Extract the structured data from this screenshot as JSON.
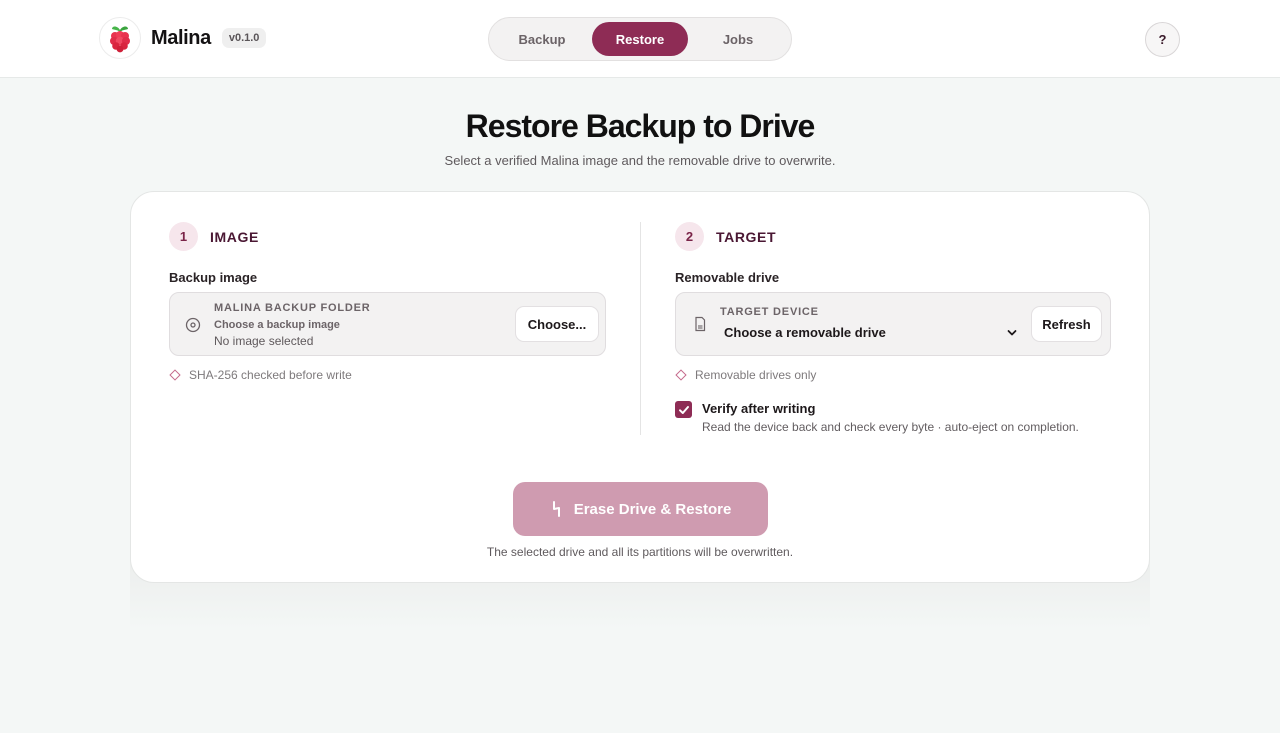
{
  "app": {
    "name": "Malina",
    "version": "v0.1.0"
  },
  "nav": {
    "tabs": [
      {
        "label": "Backup"
      },
      {
        "label": "Restore"
      },
      {
        "label": "Jobs"
      }
    ],
    "active": "Restore"
  },
  "help": {
    "label": "?"
  },
  "page": {
    "title": "Restore Backup to Drive",
    "subtitle": "Select a verified Malina image and the removable drive to overwrite."
  },
  "image_section": {
    "step": "1",
    "title": "IMAGE",
    "field_label": "Backup image",
    "caption": "MALINA BACKUP FOLDER",
    "instruction": "Choose a backup image",
    "value": "No image selected",
    "choose_label": "Choose...",
    "hint": "SHA-256 checked before write"
  },
  "target_section": {
    "step": "2",
    "title": "TARGET",
    "field_label": "Removable drive",
    "caption": "TARGET DEVICE",
    "selected": "Choose a removable drive",
    "refresh_label": "Refresh",
    "hint": "Removable drives only",
    "verify": {
      "checked": true,
      "title": "Verify after writing",
      "description": "Read the device back and check every byte · auto-eject on completion."
    }
  },
  "action": {
    "label": "Erase Drive & Restore",
    "note": "The selected drive and all its partitions will be overwritten."
  },
  "colors": {
    "accent": "#8e2c55",
    "accent_disabled": "#cf9bb0",
    "step_bg": "#f6e6ec"
  }
}
